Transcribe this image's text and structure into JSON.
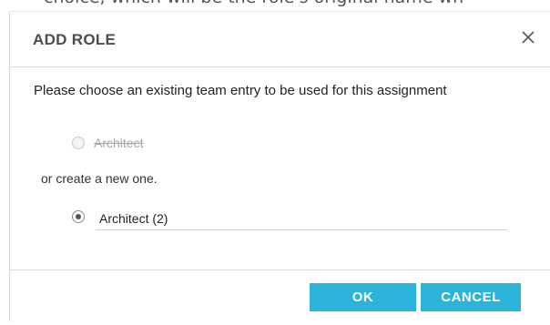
{
  "background": {
    "partial_text": "choice, which will be the role's original name wh"
  },
  "dialog": {
    "title": "ADD ROLE",
    "close_icon": "close-icon",
    "prompt": "Please choose an existing team entry to be used for this assignment",
    "existing_option": {
      "label": "Architect",
      "disabled": true,
      "selected": false
    },
    "or_text": "or create a new one.",
    "new_option": {
      "selected": true,
      "value": "Architect (2)"
    },
    "buttons": {
      "ok_label": "OK",
      "cancel_label": "CANCEL"
    },
    "colors": {
      "button": "#2cb3d9",
      "button_text": "#ffffff"
    }
  }
}
